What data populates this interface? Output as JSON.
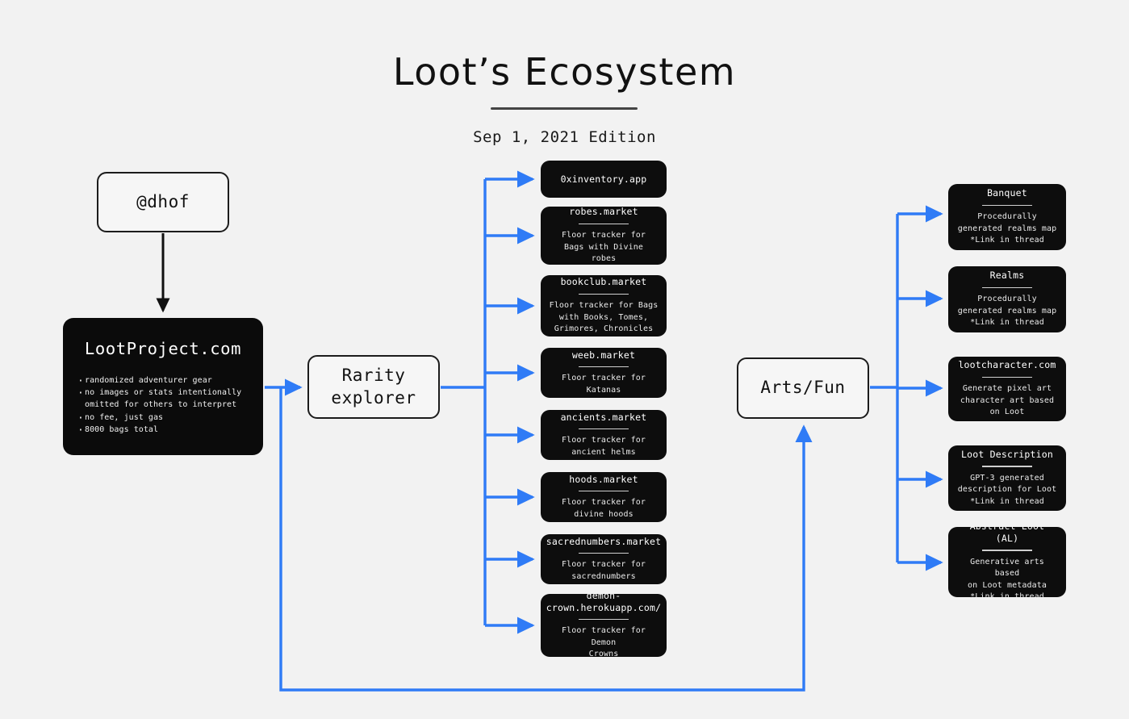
{
  "header": {
    "title": "Loot’s Ecosystem",
    "subtitle": "Sep 1, 2021 Edition"
  },
  "colors": {
    "background": "#f2f2f2",
    "node_dark": "#0d0d0d",
    "node_light": "#f6f6f6",
    "outline": "#1c1c1c",
    "connector_blue": "#2f7bf6",
    "connector_black": "#111111",
    "text_light": "#ffffff",
    "text_dark": "#111111"
  },
  "nodes": {
    "dhof": {
      "label": "@dhof"
    },
    "loot_project": {
      "title": "LootProject.com",
      "bullets": [
        "randomized adventurer gear",
        "no images or stats intentionally\nomitted for others to interpret",
        "no fee, just gas",
        "8000 bags total"
      ]
    },
    "rarity_explorer": {
      "label": "Rarity\nexplorer"
    },
    "arts_fun": {
      "label": "Arts/Fun"
    }
  },
  "rarity_cards": [
    {
      "title": "0xinventory.app",
      "desc": ""
    },
    {
      "title": "robes.market",
      "desc": "Floor tracker for\nBags with Divine\nrobes"
    },
    {
      "title": "bookclub.market",
      "desc": "Floor tracker for Bags\nwith Books, Tomes,\nGrimores, Chronicles"
    },
    {
      "title": "weeb.market",
      "desc": "Floor tracker for\nKatanas"
    },
    {
      "title": "ancients.market",
      "desc": "Floor tracker for\nancient helms"
    },
    {
      "title": "hoods.market",
      "desc": "Floor tracker for\ndivine hoods"
    },
    {
      "title": "sacrednumbers.market",
      "desc": "Floor tracker for\nsacrednumbers"
    },
    {
      "title": "demon-\ncrown.herokuapp.com/",
      "desc": "Floor tracker for Demon\nCrowns"
    }
  ],
  "arts_cards": [
    {
      "title": "Banquet",
      "desc": "Procedurally\ngenerated realms map\n*Link in thread"
    },
    {
      "title": "Realms",
      "desc": "Procedurally\ngenerated realms map\n*Link in thread"
    },
    {
      "title": "lootcharacter.com",
      "desc": "Generate pixel art\ncharacter art based\non Loot"
    },
    {
      "title": "Loot Description",
      "desc": "GPT-3 generated\ndescription for Loot\n*Link in thread"
    },
    {
      "title": "Abstract Loot (AL)",
      "desc": "Generative arts based\non Loot metadata\n*Link in thread"
    }
  ]
}
